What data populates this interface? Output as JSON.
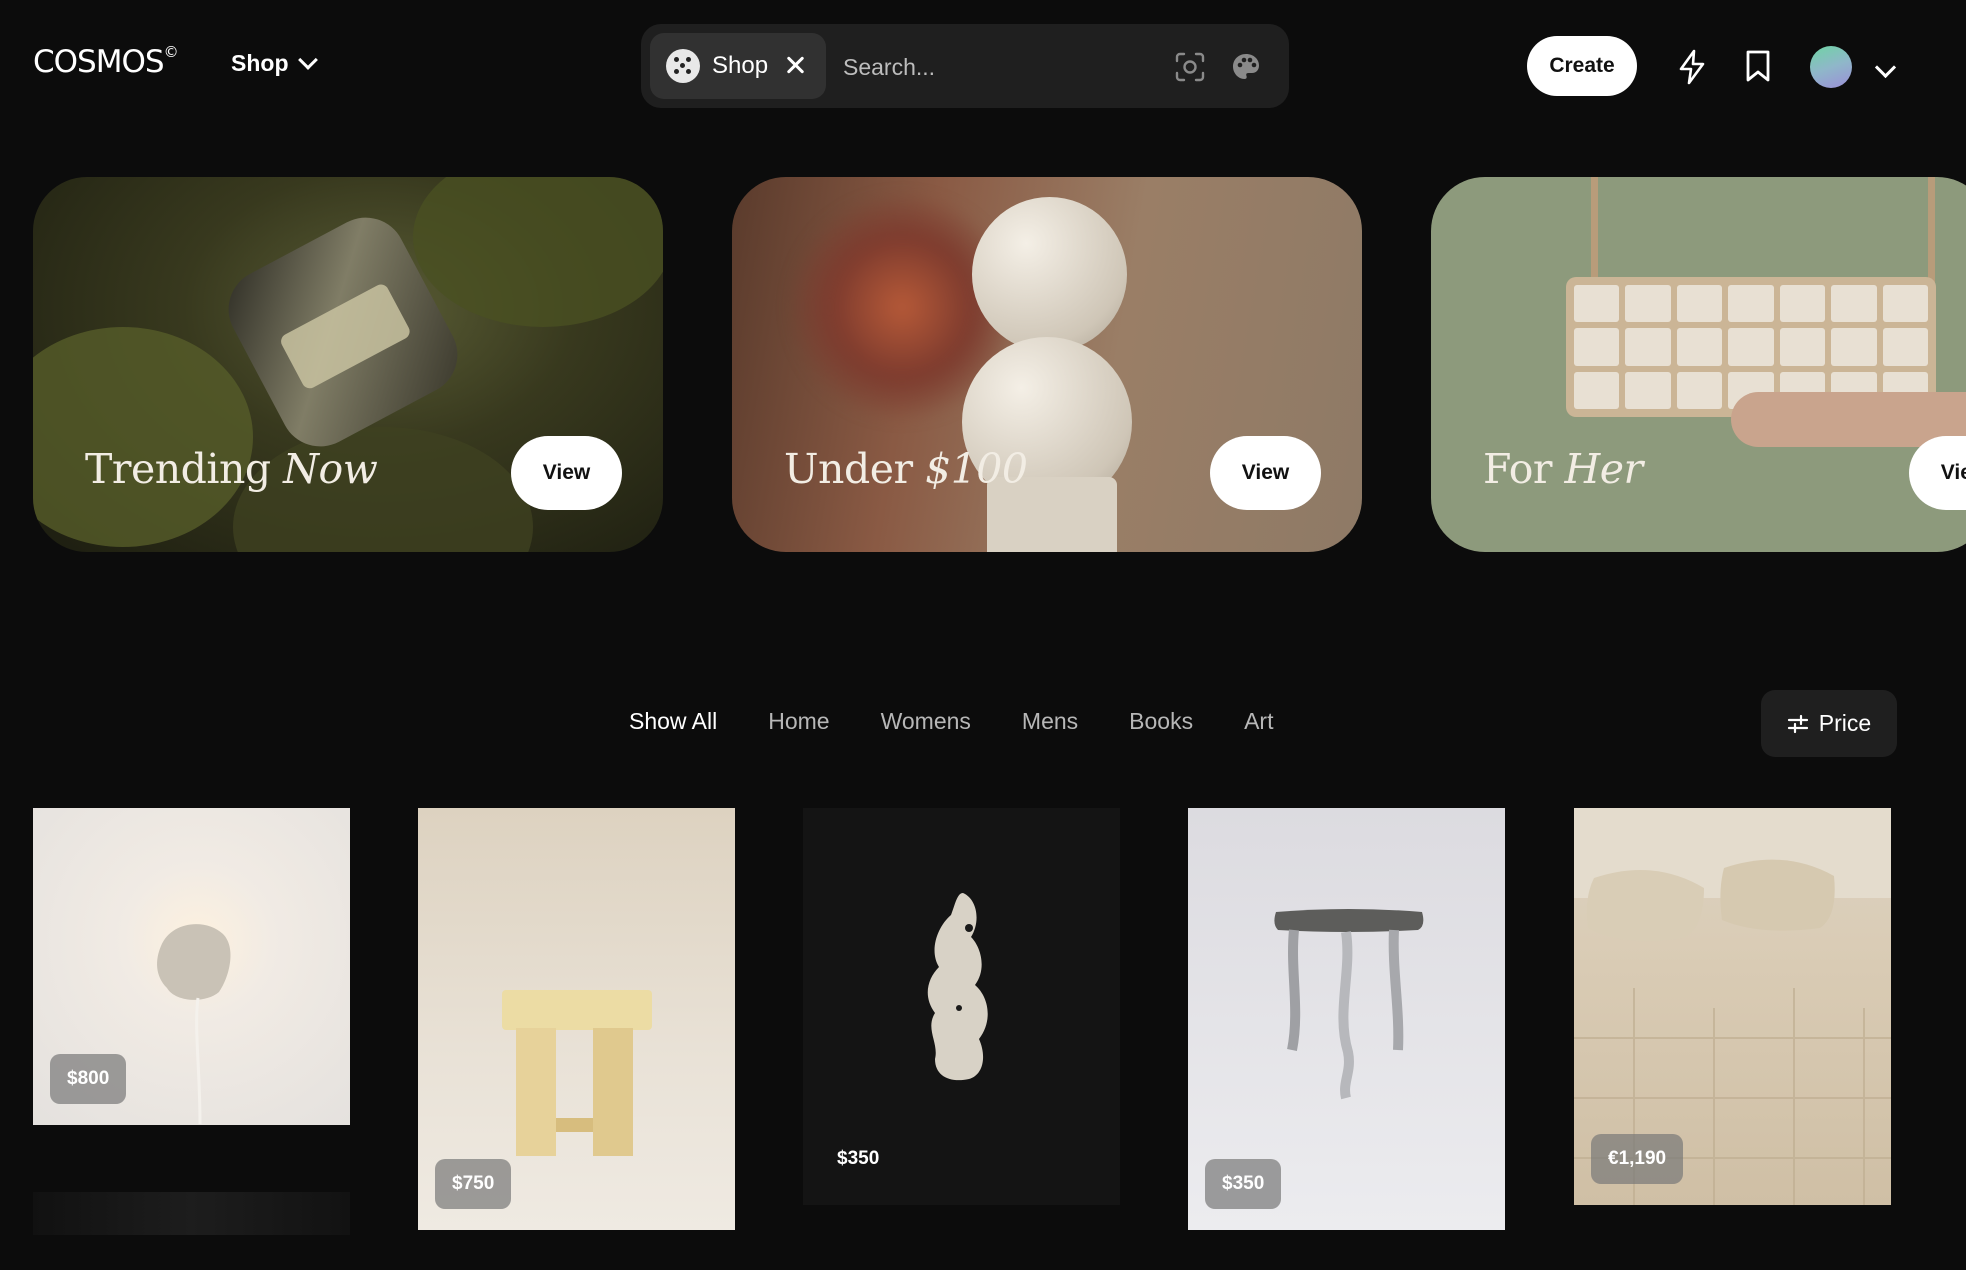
{
  "header": {
    "logo": "COSMOS",
    "logo_mark": "©",
    "shop_menu": "Shop",
    "search_chip": "Shop",
    "search_placeholder": "Search...",
    "create_label": "Create",
    "icons": [
      "lens-icon",
      "palette-icon",
      "bolt-icon",
      "bookmark-icon"
    ]
  },
  "hero_cards": [
    {
      "title_plain": "Trending ",
      "title_italic": "Now",
      "button": "View"
    },
    {
      "title_plain": "Under ",
      "title_italic": "$100",
      "button": "View"
    },
    {
      "title_plain": "For ",
      "title_italic": "Her",
      "button": "View"
    }
  ],
  "filters": [
    "Show All",
    "Home",
    "Womens",
    "Mens",
    "Books",
    "Art"
  ],
  "active_filter": "Show All",
  "price_button": "Price",
  "products": [
    {
      "price": "$800"
    },
    {
      "price": "$750"
    },
    {
      "price": "$350"
    },
    {
      "price": "$350"
    },
    {
      "price": "€1,190"
    }
  ],
  "colors": {
    "background": "#0c0c0c",
    "surface": "#1f1f1f",
    "button": "#ffffff"
  }
}
